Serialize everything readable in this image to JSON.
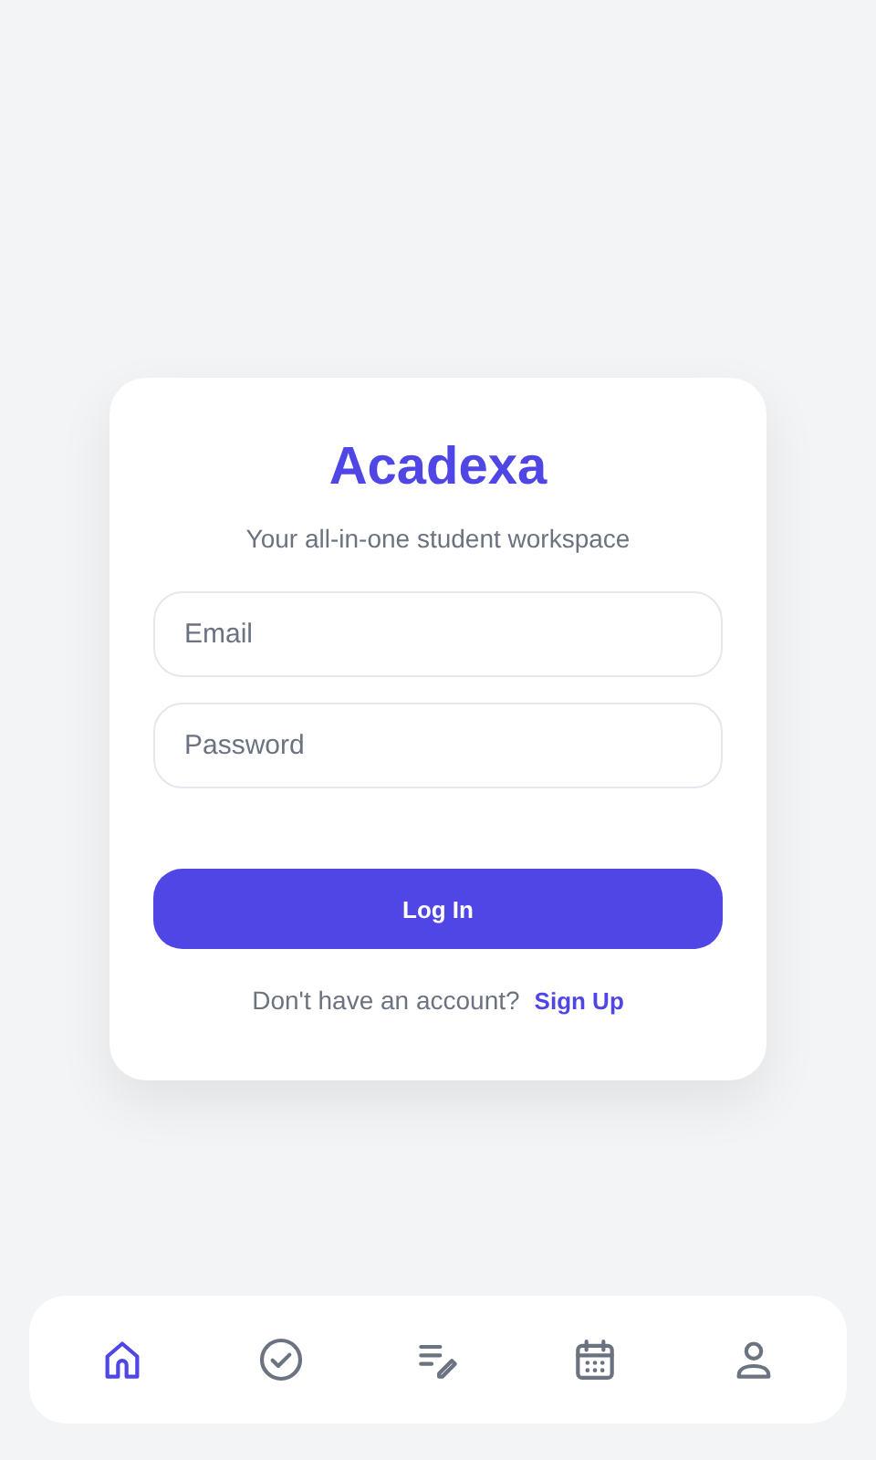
{
  "login_card": {
    "title": "Acadexa",
    "subtitle": "Your all-in-one student workspace",
    "fields": [
      {
        "placeholder": "Email"
      },
      {
        "placeholder": "Password"
      }
    ],
    "button": "Log In",
    "signup_prompt": "Don't have an account?",
    "signup_link": "Sign Up"
  },
  "bottom_nav": [
    {
      "kind": "home",
      "selected": true
    },
    {
      "kind": "check",
      "selected": false
    },
    {
      "kind": "notes",
      "selected": false
    },
    {
      "kind": "calendar",
      "selected": false
    },
    {
      "kind": "user",
      "selected": false
    }
  ]
}
